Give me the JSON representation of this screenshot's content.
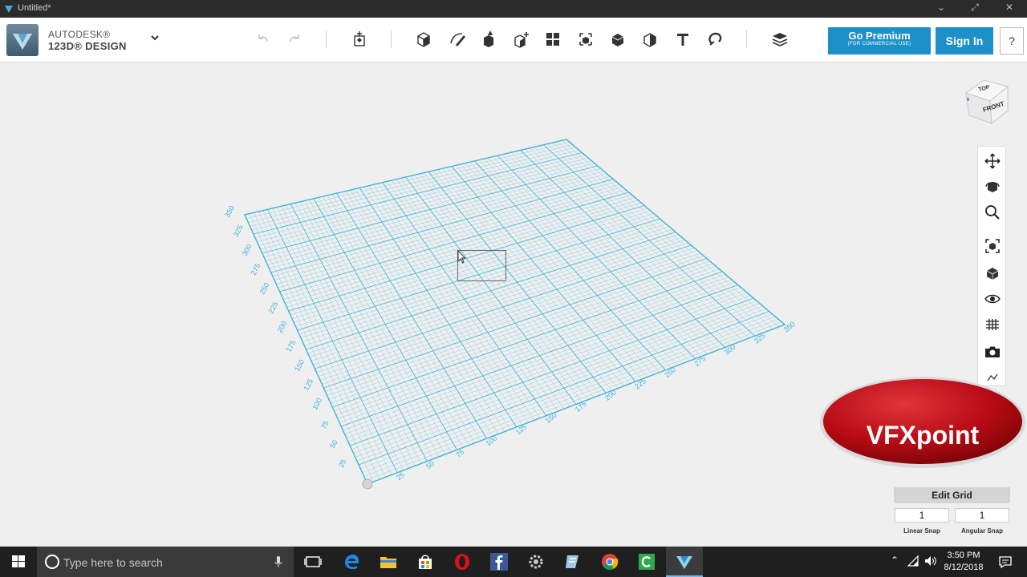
{
  "window": {
    "title": "Untitled*"
  },
  "brand": {
    "line1": "AUTODESK®",
    "line2": "123D® DESIGN"
  },
  "toolbar": {
    "undo_icon": "undo-icon",
    "redo_icon": "redo-icon",
    "tools": [
      "transform-icon",
      "primitives-icon",
      "sketch-icon",
      "construct-icon",
      "modify-icon",
      "pattern-icon",
      "grouping-icon",
      "combine-icon",
      "measure-icon",
      "text-icon",
      "snap-icon",
      "materials-icon"
    ],
    "premium_label": "Go Premium",
    "premium_sub": "(FOR COMMERCIAL USE)",
    "signin_label": "Sign In",
    "help_label": "?"
  },
  "viewcube": {
    "top": "TOP",
    "front": "FRONT"
  },
  "nav_tools": [
    "pan-icon",
    "orbit-icon",
    "zoom-icon",
    "fit-icon",
    "views-icon",
    "visibility-icon",
    "grid-icon",
    "camera-icon",
    "more-icon"
  ],
  "watermark": {
    "text": "VFXpoint"
  },
  "grid_panel": {
    "title": "Edit Grid",
    "linear_snap_value": "1",
    "angular_snap_value": "1",
    "linear_snap_label": "Linear Snap",
    "angular_snap_label": "Angular Snap"
  },
  "grid_labels": {
    "left_axis": [
      "25",
      "50",
      "75",
      "100",
      "125",
      "150",
      "175",
      "200",
      "225",
      "250",
      "275",
      "300",
      "325",
      "350"
    ],
    "bottom_axis": [
      "25",
      "50",
      "75",
      "100",
      "125",
      "150",
      "175",
      "200",
      "225",
      "250",
      "275",
      "300",
      "325",
      "350"
    ]
  },
  "taskbar": {
    "search_placeholder": "Type here to search",
    "time": "3:50 PM",
    "date": "8/12/2018"
  },
  "colors": {
    "grid": "#3fb4d8",
    "accent": "#1e90c9",
    "badge": "#c8101a"
  }
}
